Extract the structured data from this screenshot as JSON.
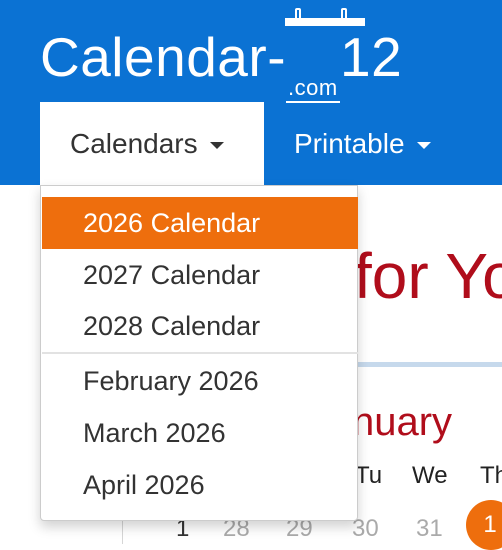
{
  "logo": {
    "name": "Calendar-",
    "number": "12",
    "domain": ".com"
  },
  "nav": {
    "calendars_label": "Calendars",
    "printable_label": "Printable"
  },
  "dropdown": {
    "items": [
      {
        "label": "2026 Calendar",
        "active": true
      },
      {
        "label": "2027 Calendar",
        "active": false
      },
      {
        "label": "2028 Calendar",
        "active": false
      },
      {
        "label": "February 2026",
        "active": false
      },
      {
        "label": "March 2026",
        "active": false
      },
      {
        "label": "April 2026",
        "active": false
      }
    ]
  },
  "page": {
    "title_fragment": "for Yo",
    "month_fragment": "nuary",
    "weekdays": [
      "Tu",
      "We",
      "Th"
    ],
    "days": [
      "1",
      "28",
      "29",
      "30",
      "31"
    ],
    "today": "1"
  },
  "colors": {
    "header_blue": "#0b72d3",
    "accent_orange": "#ee6e0d",
    "title_red": "#b00d1b"
  }
}
